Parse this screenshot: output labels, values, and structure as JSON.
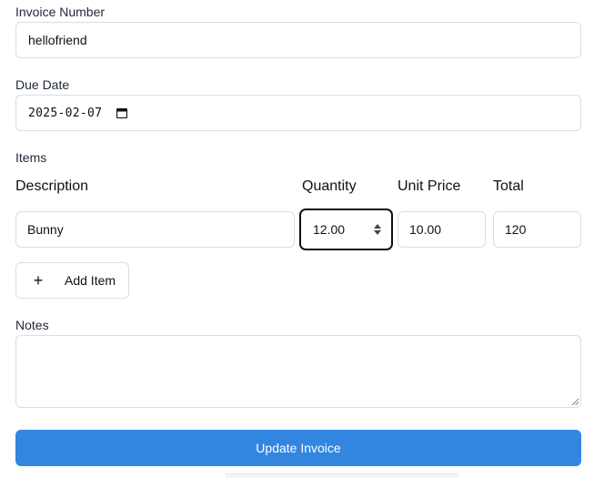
{
  "invoice_number": {
    "label": "Invoice Number",
    "value": "hellofriend"
  },
  "due_date": {
    "label": "Due Date",
    "value": "2025-02-07",
    "icon": "calendar-icon"
  },
  "items": {
    "label": "Items",
    "headers": {
      "description": "Description",
      "quantity": "Quantity",
      "unit_price": "Unit Price",
      "total": "Total"
    },
    "rows": [
      {
        "description": "Bunny",
        "quantity": "12.00",
        "unit_price": "10.00",
        "total": "120"
      }
    ],
    "add_item_label": "Add Item",
    "add_icon": "plus-icon"
  },
  "notes": {
    "label": "Notes",
    "value": ""
  },
  "submit_label": "Update Invoice",
  "colors": {
    "primary": "#3286e0",
    "border": "#d9dde3",
    "focus": "#111111"
  }
}
